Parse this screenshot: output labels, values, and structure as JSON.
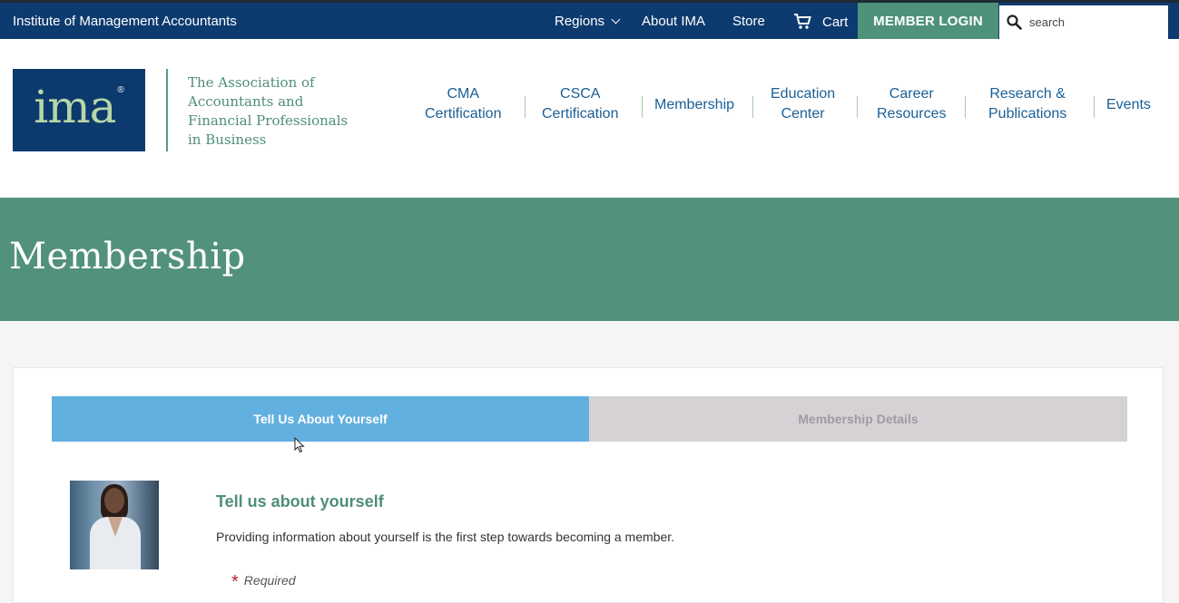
{
  "topbar": {
    "org_name": "Institute of Management Accountants",
    "links": {
      "regions": "Regions",
      "about": "About IMA",
      "store": "Store",
      "cart": "Cart"
    },
    "login_label": "MEMBER LOGIN",
    "search_placeholder": "search"
  },
  "header": {
    "logo_text": "ima",
    "logo_reg": "®",
    "tagline_lines": [
      "The Association of",
      "Accountants and",
      "Financial Professionals",
      "in Business"
    ]
  },
  "nav": {
    "items": [
      {
        "line1": "CMA",
        "line2": "Certification"
      },
      {
        "line1": "CSCA",
        "line2": "Certification"
      },
      {
        "line1": "Membership",
        "line2": ""
      },
      {
        "line1": "Education",
        "line2": "Center"
      },
      {
        "line1": "Career",
        "line2": "Resources"
      },
      {
        "line1": "Research &",
        "line2": "Publications"
      },
      {
        "line1": "Events",
        "line2": ""
      }
    ]
  },
  "hero": {
    "title": "Membership"
  },
  "steps": {
    "active": "Tell Us About Yourself",
    "inactive": "Membership Details"
  },
  "section": {
    "title": "Tell us about yourself",
    "description": "Providing information about yourself is the first step towards becoming a member.",
    "required_star": "*",
    "required_label": "Required"
  },
  "colors": {
    "topbar": "#0d3b6f",
    "accent_green": "#52917a",
    "tab_active": "#62b0e0",
    "tab_inactive": "#d5d1d4",
    "nav_text": "#1a5f96"
  },
  "icons": [
    "chevron-down-icon",
    "cart-icon",
    "search-icon",
    "cursor-icon"
  ]
}
